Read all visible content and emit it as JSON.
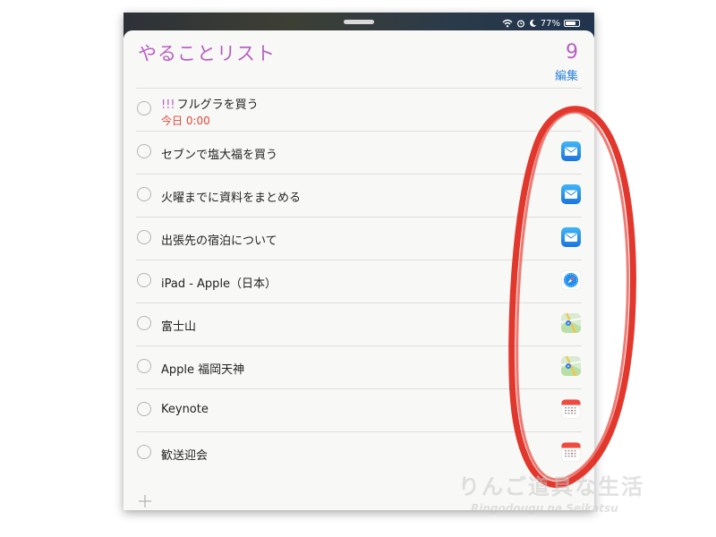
{
  "status_bar": {
    "battery_percent": "77%",
    "battery_level": 0.77,
    "icons": [
      "wifi-icon",
      "alarm-icon",
      "moon-icon",
      "battery-icon"
    ]
  },
  "header": {
    "title": "やることリスト",
    "count": "9",
    "edit_label": "編集"
  },
  "colors": {
    "accent": "#b85fc4",
    "link": "#2f86d6",
    "due": "#e0483a",
    "annotation": "#e0261b"
  },
  "reminders": [
    {
      "priority": "!!!",
      "title": "フルグラを買う",
      "due": "今日 0:00",
      "app_icon": ""
    },
    {
      "title": "セブンで塩大福を買う",
      "app_icon": "mail-icon"
    },
    {
      "title": "火曜までに資料をまとめる",
      "app_icon": "mail-icon"
    },
    {
      "title": "出張先の宿泊について",
      "app_icon": "mail-icon"
    },
    {
      "title": "iPad - Apple（日本）",
      "app_icon": "safari-icon"
    },
    {
      "title": "富士山",
      "app_icon": "maps-icon"
    },
    {
      "title": "Apple 福岡天神",
      "app_icon": "maps-icon"
    },
    {
      "title": "Keynote",
      "app_icon": "calendar-icon"
    },
    {
      "title": "歓送迎会",
      "app_icon": "calendar-icon"
    }
  ],
  "watermark": {
    "jp": "りんご道具な生活",
    "en": "Ringodougu na Seikatsu"
  }
}
